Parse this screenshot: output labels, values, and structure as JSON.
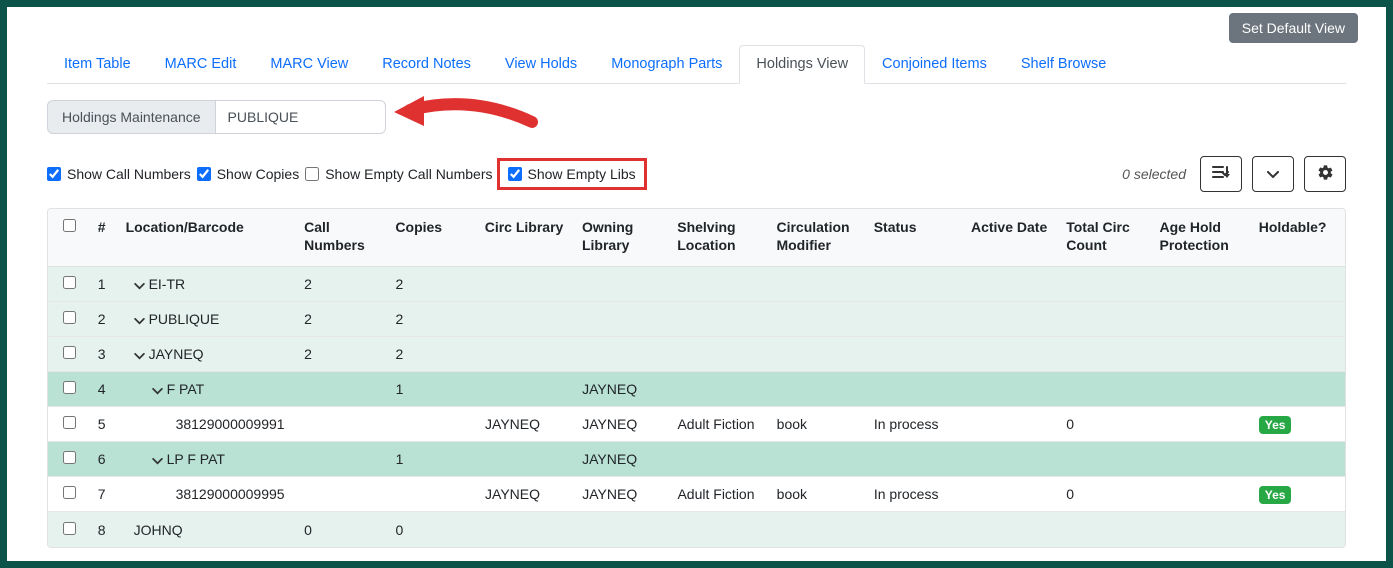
{
  "header": {
    "set_default": "Set Default View"
  },
  "tabs": [
    {
      "label": "Item Table",
      "active": false
    },
    {
      "label": "MARC Edit",
      "active": false
    },
    {
      "label": "MARC View",
      "active": false
    },
    {
      "label": "Record Notes",
      "active": false
    },
    {
      "label": "View Holds",
      "active": false
    },
    {
      "label": "Monograph Parts",
      "active": false
    },
    {
      "label": "Holdings View",
      "active": true
    },
    {
      "label": "Conjoined Items",
      "active": false
    },
    {
      "label": "Shelf Browse",
      "active": false
    }
  ],
  "toolbar": {
    "maintenance_label": "Holdings Maintenance",
    "search_value": "PUBLIQUE"
  },
  "filters": {
    "show_call_numbers": {
      "label": "Show Call Numbers",
      "checked": true
    },
    "show_copies": {
      "label": "Show Copies",
      "checked": true
    },
    "show_empty_call_numbers": {
      "label": "Show Empty Call Numbers",
      "checked": false
    },
    "show_empty_libs": {
      "label": "Show Empty Libs",
      "checked": true
    },
    "selected_text": "0 selected"
  },
  "columns": {
    "num": "#",
    "loc": "Location/Barcode",
    "cn": "Call Numbers",
    "copies": "Copies",
    "circ": "Circ Library",
    "own": "Owning Library",
    "shelve": "Shelving Location",
    "circmod": "Circulation Modifier",
    "status": "Status",
    "active": "Active Date",
    "tcirc": "Total Circ Count",
    "age": "Age Hold Protection",
    "hold": "Holdable?"
  },
  "rows": [
    {
      "num": "1",
      "loc": "EI-TR",
      "indent": "indent-1",
      "caret": true,
      "cn": "2",
      "copies": "2",
      "circ": "",
      "own": "",
      "shelve": "",
      "circmod": "",
      "status": "",
      "active": "",
      "tcirc": "",
      "age": "",
      "hold": "",
      "row_class": "green-light"
    },
    {
      "num": "2",
      "loc": "PUBLIQUE",
      "indent": "indent-1",
      "caret": true,
      "cn": "2",
      "copies": "2",
      "circ": "",
      "own": "",
      "shelve": "",
      "circmod": "",
      "status": "",
      "active": "",
      "tcirc": "",
      "age": "",
      "hold": "",
      "row_class": "green-light"
    },
    {
      "num": "3",
      "loc": "JAYNEQ",
      "indent": "indent-1",
      "caret": true,
      "cn": "2",
      "copies": "2",
      "circ": "",
      "own": "",
      "shelve": "",
      "circmod": "",
      "status": "",
      "active": "",
      "tcirc": "",
      "age": "",
      "hold": "",
      "row_class": "green-light"
    },
    {
      "num": "4",
      "loc": "F PAT",
      "indent": "indent-2",
      "caret": true,
      "cn": "",
      "copies": "1",
      "circ": "",
      "own": "JAYNEQ",
      "shelve": "",
      "circmod": "",
      "status": "",
      "active": "",
      "tcirc": "",
      "age": "",
      "hold": "",
      "row_class": "green-med"
    },
    {
      "num": "5",
      "loc": "38129000009991",
      "indent": "indent-barcode",
      "caret": false,
      "cn": "",
      "copies": "",
      "circ": "JAYNEQ",
      "own": "JAYNEQ",
      "shelve": "Adult Fiction",
      "circmod": "book",
      "status": "In process",
      "active": "",
      "tcirc": "0",
      "age": "",
      "hold": "Yes",
      "row_class": "white-row"
    },
    {
      "num": "6",
      "loc": "LP F PAT",
      "indent": "indent-2",
      "caret": true,
      "cn": "",
      "copies": "1",
      "circ": "",
      "own": "JAYNEQ",
      "shelve": "",
      "circmod": "",
      "status": "",
      "active": "",
      "tcirc": "",
      "age": "",
      "hold": "",
      "row_class": "green-med"
    },
    {
      "num": "7",
      "loc": "38129000009995",
      "indent": "indent-barcode",
      "caret": false,
      "cn": "",
      "copies": "",
      "circ": "JAYNEQ",
      "own": "JAYNEQ",
      "shelve": "Adult Fiction",
      "circmod": "book",
      "status": "In process",
      "active": "",
      "tcirc": "0",
      "age": "",
      "hold": "Yes",
      "row_class": "white-row"
    },
    {
      "num": "8",
      "loc": "JOHNQ",
      "indent": "indent-1",
      "caret": false,
      "cn": "0",
      "copies": "0",
      "circ": "",
      "own": "",
      "shelve": "",
      "circmod": "",
      "status": "",
      "active": "",
      "tcirc": "",
      "age": "",
      "hold": "",
      "row_class": "green-light"
    }
  ]
}
